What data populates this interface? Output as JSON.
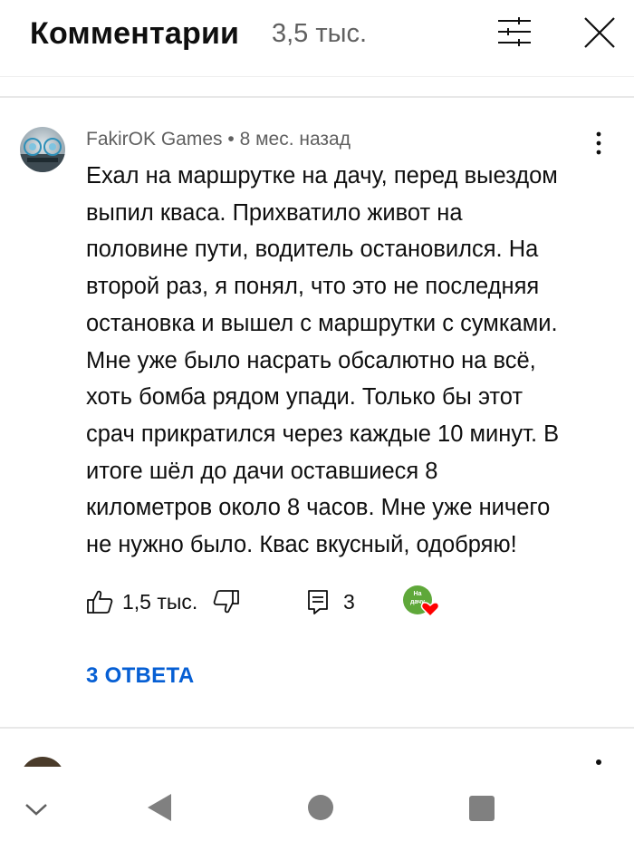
{
  "header": {
    "title": "Комментарии",
    "count": "3,5 тыс."
  },
  "comment": {
    "author": "FakirOK Games",
    "separator": "•",
    "time": "8 мес. назад",
    "text": "Ехал на маршрутке на дачу, перед выездом\nвыпил кваса. Прихватило живот на\nполовине пути, водитель остановился. На\nвторой раз, я понял, что это не последняя\nостановка и вышел с маршрутки с сумками.\nМне уже было насрать обсалютно на всё,\nхоть бомба рядом упади. Только бы этот\nсрач прикратился через каждые 10 минут. В\nитоге шёл до дачи оставшиеся 8\nкилометров около 8 часов. Мне уже ничего\nне нужно было. Квас вкусный, одобряю!",
    "likes": "1,5 тыс.",
    "replies_count": "3",
    "heart_badge_text": "На дачу",
    "replies_link": "3 ОТВЕТА"
  },
  "icons": {
    "filter": "filter-icon",
    "close": "close-icon",
    "more": "more-vert-icon",
    "like": "thumb-up-icon",
    "dislike": "thumb-down-icon",
    "reply": "comment-icon",
    "heart": "heart-icon",
    "nav_hide": "chevron-down-icon",
    "nav_back": "back-triangle-icon",
    "nav_home": "home-circle-icon",
    "nav_recents": "recents-square-icon"
  },
  "colors": {
    "link": "#065fd4",
    "secondary_text": "#606060",
    "heart": "#ff0000",
    "badge_green": "#5fa83a"
  }
}
